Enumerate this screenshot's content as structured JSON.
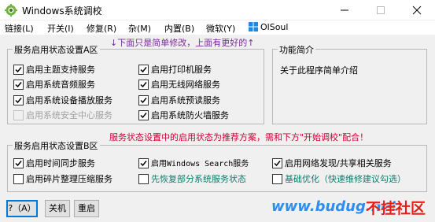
{
  "window": {
    "title": "Windows系统调校"
  },
  "menu": {
    "items": [
      "链接(L)",
      "开关(I)",
      "修复(R)",
      "杂(M)",
      "内置(B)",
      "微软(Y)",
      "OlSoul"
    ]
  },
  "notice_top": "↓下面只是简单修改，上面有更好的↑",
  "group_a": {
    "legend": "服务启用状态设置A区",
    "checkboxes": [
      {
        "label": "启用主题支持服务",
        "checked": true
      },
      {
        "label": "启用系统音频服务",
        "checked": true
      },
      {
        "label": "启用系统设备播放服务",
        "checked": true
      },
      {
        "label": "启用系统安全中心服务",
        "checked": false,
        "disabled": true
      },
      {
        "label": "启用打印机服务",
        "checked": true
      },
      {
        "label": "启用无线网络服务",
        "checked": true
      },
      {
        "label": "启用系统预读服务",
        "checked": true
      },
      {
        "label": "启用系统防火墙服务",
        "checked": true
      }
    ]
  },
  "func_intro": {
    "legend": "功能简介",
    "text": "关于此程序简单介绍"
  },
  "notice_mid": "服务状态设置中的启用状态为推荐方案，需和下方\"开始调校\"配合！",
  "group_b": {
    "legend": "服务启用状态设置B区",
    "checkboxes": [
      {
        "label": "启用时间同步服务",
        "checked": true
      },
      {
        "label": "启用碎片整理压缩服务",
        "checked": false
      },
      {
        "label": "启用Windows Search服务",
        "checked": true
      },
      {
        "label": "先恢复部分系统服务状态",
        "checked": false,
        "teal": true
      },
      {
        "label": "启用网络发现/共享相关服务",
        "checked": true
      },
      {
        "label": "基础优化（快速维修建议勾选）",
        "checked": false,
        "teal": true
      }
    ]
  },
  "buttons": {
    "help": "?（A）",
    "shutdown": "关机",
    "restart": "重启"
  },
  "watermark": {
    "url": "www.budug.net",
    "logo": "不挂社区"
  },
  "colors": {
    "notice_red": "#cc0033",
    "teal_text": "#0e7a6e",
    "watermark_blue": "#2c8ff0",
    "watermark_red": "#e81c1c"
  }
}
